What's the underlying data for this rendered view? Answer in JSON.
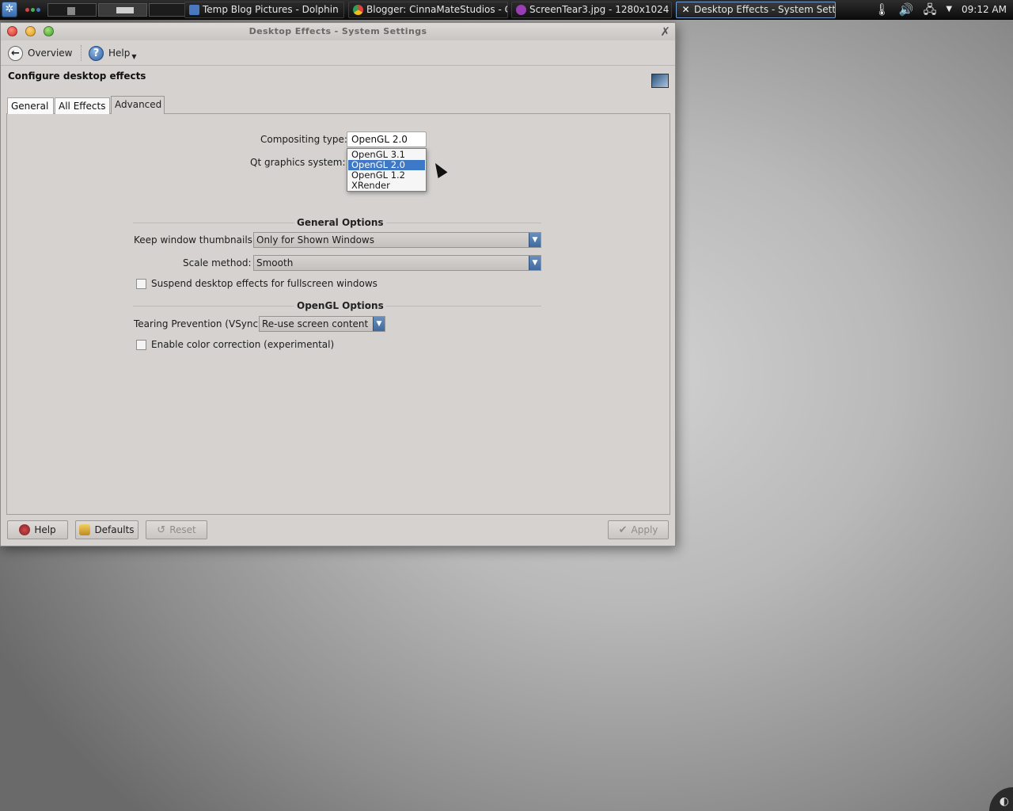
{
  "panel": {
    "tasks": [
      {
        "label": "Temp Blog Pictures - Dolphin",
        "icon": "dolphin-icon",
        "color": "#4a78c0"
      },
      {
        "label": "Blogger: CinnaMateStudios - C",
        "icon": "chrome-icon",
        "color": "#e0a020"
      },
      {
        "label": "ScreenTear3.jpg - 1280x1024",
        "icon": "image-viewer-icon",
        "color": "#9a3fb3"
      },
      {
        "label": "Desktop Effects - System Sett",
        "icon": "system-settings-icon",
        "color": "#ffffff"
      }
    ],
    "clock": "09:12 AM"
  },
  "window": {
    "title": "Desktop Effects - System Settings",
    "toolbar": {
      "overview": "Overview",
      "help": "Help"
    },
    "heading": "Configure desktop effects",
    "tabs": [
      "General",
      "All Effects",
      "Advanced"
    ],
    "active_tab": "Advanced",
    "advanced": {
      "compositing_label": "Compositing type:",
      "compositing_value": "OpenGL 2.0",
      "compositing_options": [
        "OpenGL 3.1",
        "OpenGL 2.0",
        "OpenGL 1.2",
        "XRender"
      ],
      "highlighted_option": "OpenGL 2.0",
      "qt_label": "Qt graphics system:",
      "general_options_title": "General Options",
      "thumbnails_label": "Keep window thumbnails:",
      "thumbnails_value": "Only for Shown Windows",
      "scale_label": "Scale method:",
      "scale_value": "Smooth",
      "suspend_label": "Suspend desktop effects for fullscreen windows",
      "suspend_checked": false,
      "opengl_options_title": "OpenGL Options",
      "vsync_label": "Tearing Prevention (VSync)",
      "vsync_value": "Re-use screen content",
      "color_correction_label": "Enable color correction (experimental)",
      "color_correction_checked": false
    },
    "buttons": {
      "help": "Help",
      "defaults": "Defaults",
      "reset": "Reset",
      "apply": "Apply"
    }
  },
  "colors": {
    "accent": "#3e79c8",
    "window_bg": "#d5d2cf"
  }
}
